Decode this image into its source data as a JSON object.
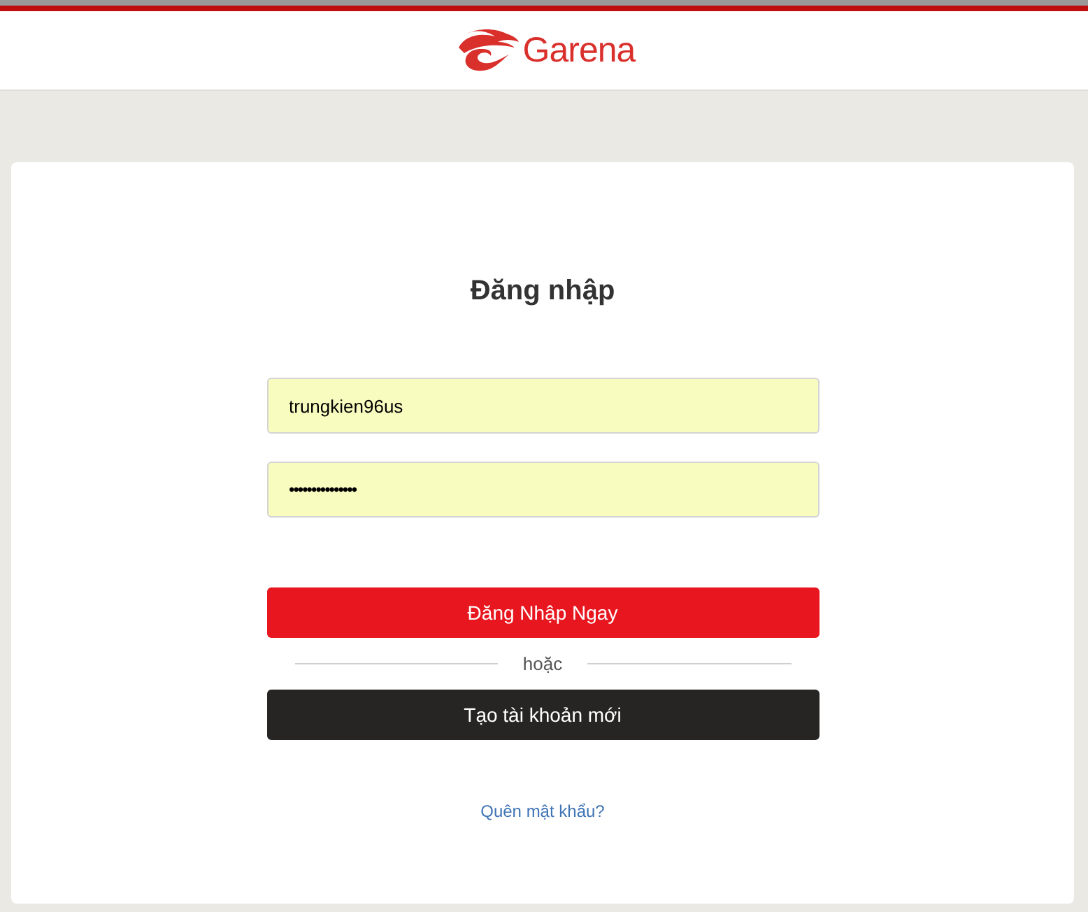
{
  "header": {
    "logo_text": "Garena"
  },
  "login": {
    "title": "Đăng nhập",
    "fields": [
      {
        "kind": "text",
        "value": "trungkien96us"
      },
      {
        "kind": "password",
        "value": "•••••••••••••••"
      }
    ],
    "submit": "Đăng Nhập Ngay",
    "divider": "hoặc",
    "register": "Tạo tài khoản mới",
    "forgot": "Quên mật khẩu?"
  }
}
